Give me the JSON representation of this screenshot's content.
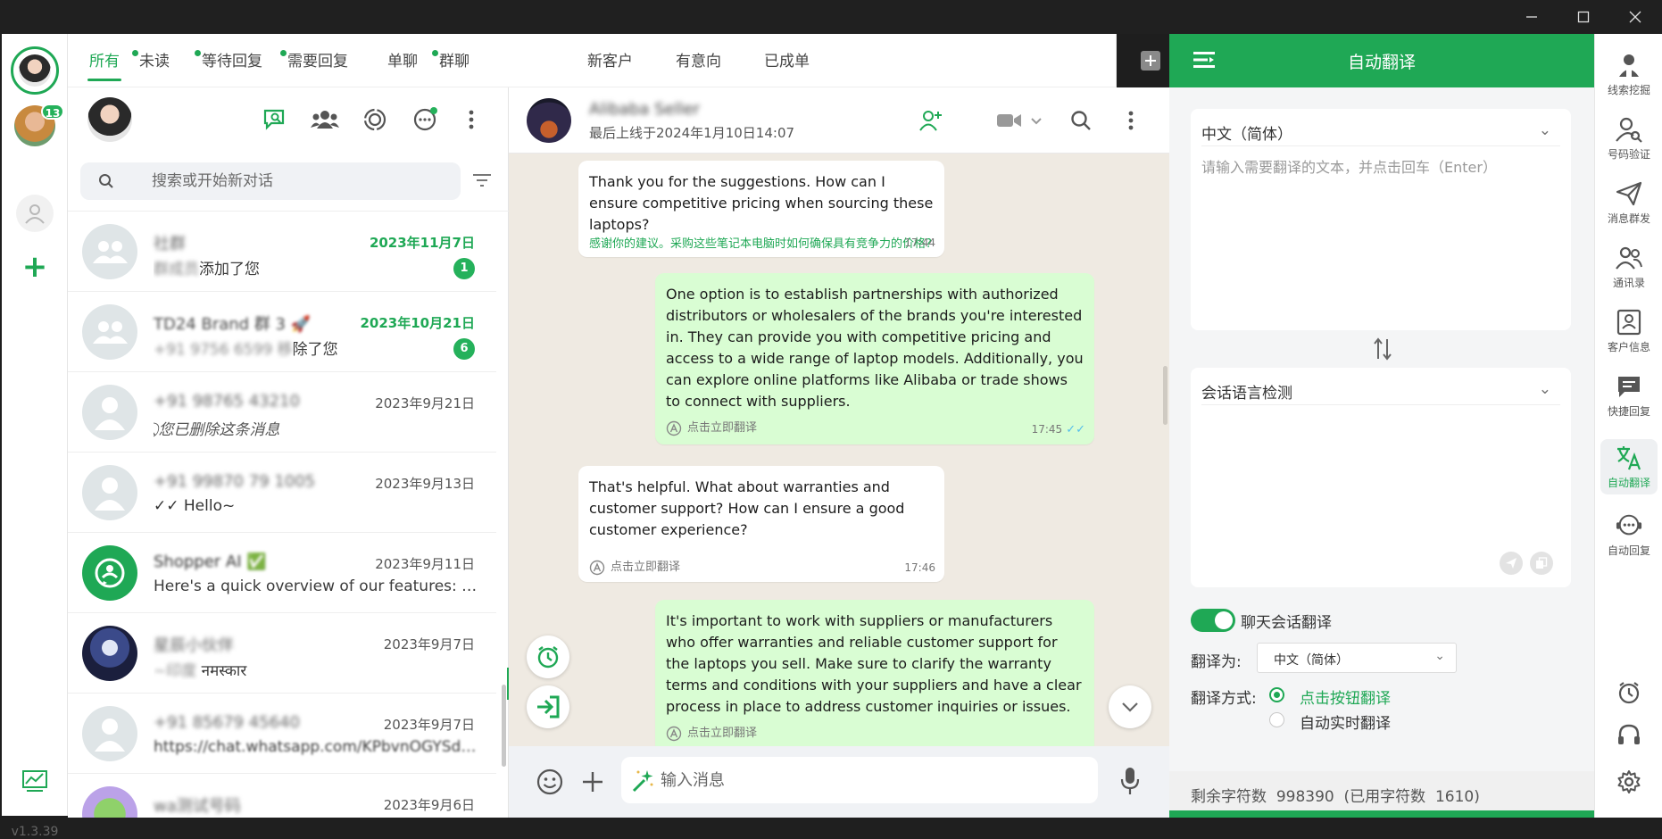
{
  "window": {
    "title": ""
  },
  "rail": {
    "badge": "13",
    "version": "v1.3.39"
  },
  "tabs": [
    {
      "label": "所有",
      "active": true,
      "dot": false
    },
    {
      "label": "未读",
      "dot": true
    },
    {
      "label": "等待回复",
      "dot": true
    },
    {
      "label": "需要回复",
      "dot": true
    },
    {
      "label": "单聊",
      "dot": false
    },
    {
      "label": "群聊",
      "dot": true
    },
    {
      "label": "新客户",
      "dot": false
    },
    {
      "label": "有意向",
      "dot": false
    },
    {
      "label": "已成单",
      "dot": false
    }
  ],
  "search": {
    "placeholder": "搜索或开始新对话"
  },
  "chats": [
    {
      "name": "社群",
      "date": "2023年11月7日",
      "date_green": true,
      "preview_blur": "群成员",
      "preview": "添加了您",
      "unread": "1",
      "avatar": "group"
    },
    {
      "name": "TD24 Brand 群 3 🚀",
      "date": "2023年10月21日",
      "date_green": true,
      "preview_blur": "+91 9756 6599 移",
      "preview": "除了您",
      "unread": "6",
      "avatar": "group"
    },
    {
      "name": "+91 98765 43210",
      "date": "2023年9月21日",
      "date_green": false,
      "preview": "⃠ 您已删除这条消息",
      "italic": true,
      "avatar": "person"
    },
    {
      "name": "+91 99870 79 1005",
      "date": "2023年9月13日",
      "date_green": false,
      "preview": "✓✓ Hello~",
      "avatar": "person"
    },
    {
      "name": "Shopper AI ✅",
      "date": "2023年9月11日",
      "date_green": false,
      "preview": "Here's a quick overview of our features: 💬 C...",
      "avatar": "bot"
    },
    {
      "name": "星辰小伙伴",
      "date": "2023年9月7日",
      "date_green": false,
      "preview_blur": "~印度",
      "preview": " नमस्कार",
      "avatar": "photo"
    },
    {
      "name": "+91 85679 45640",
      "date": "2023年9月7日",
      "date_green": false,
      "preview": "https://chat.whatsapp.com/KPbvnOGYSdp0r...",
      "blur_all": true,
      "avatar": "person"
    },
    {
      "name": "wa测试号码",
      "date": "2023年9月6日",
      "date_green": false,
      "preview": "",
      "avatar": "frog"
    }
  ],
  "conversation": {
    "name": "Alibaba Seller",
    "last_seen": "最后上线于2024年1月10日14:07",
    "composer_placeholder": "输入消息",
    "messages": [
      {
        "dir": "in",
        "text": "Thank you for the suggestions. How can I ensure competitive pricing when sourcing these laptops?",
        "translation": "感谢你的建议。采购这些笔记本电脑时如何确保具有竞争力的价格?",
        "time": "17:44"
      },
      {
        "dir": "out",
        "text": "One option is to establish partnerships with authorized distributors or wholesalers of the brands you're interested in. They can provide you with competitive pricing and access to a wide range of laptop models. Additionally, you can explore online platforms like Alibaba or trade shows to connect with suppliers.",
        "translate_btn": "点击立即翻译",
        "time": "17:45",
        "tick": "✓✓"
      },
      {
        "dir": "in",
        "text": "That's helpful. What about warranties and customer support? How can I ensure a good customer experience?",
        "translate_btn": "点击立即翻译",
        "time": "17:46"
      },
      {
        "dir": "out",
        "text": "It's important to work with suppliers or manufacturers who offer warranties and reliable customer support for the laptops you sell. Make sure to clarify the warranty terms and conditions with your suppliers and have a clear process in place to address customer inquiries or issues.",
        "translate_btn": "点击立即翻译",
        "time": ""
      }
    ]
  },
  "translate": {
    "title": "自动翻译",
    "source_lang": "中文（简体）",
    "input_placeholder": "请输入需要翻译的文本，并点击回车（Enter）",
    "detect_lang": "会话语言检测",
    "toggle_label": "聊天会话翻译",
    "translate_to_label": "翻译为:",
    "translate_to_value": "中文（简体）",
    "method_label": "翻译方式:",
    "method_button": "点击按钮翻译",
    "method_auto": "自动实时翻译",
    "remaining_label": "剩余字符数",
    "remaining_value": "998390",
    "used_label": "(已用字符数",
    "used_value": "1610)"
  },
  "tools": [
    {
      "label": "线索挖掘",
      "icon": "person-dig-icon"
    },
    {
      "label": "号码验证",
      "icon": "person-search-icon"
    },
    {
      "label": "消息群发",
      "icon": "send-icon"
    },
    {
      "label": "通讯录",
      "icon": "contacts-icon"
    },
    {
      "label": "客户信息",
      "icon": "id-card-icon"
    },
    {
      "label": "快捷回复",
      "icon": "chat-icon"
    },
    {
      "label": "自动翻译",
      "icon": "translate-icon",
      "active": true
    },
    {
      "label": "自动回复",
      "icon": "auto-reply-icon"
    }
  ],
  "colors": {
    "accent": "#1fa855",
    "out_bubble": "#d9fdd3",
    "chat_bg": "#efeae2"
  }
}
